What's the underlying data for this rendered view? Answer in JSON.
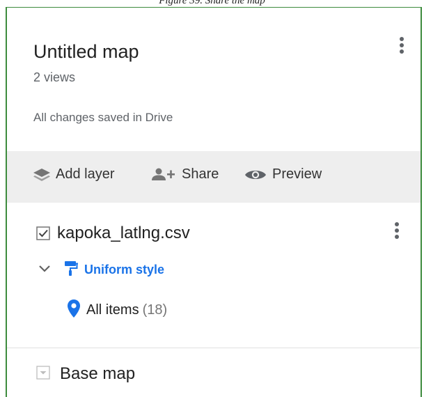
{
  "caption": "Figure 39. Share the map",
  "map": {
    "title": "Untitled map",
    "views": "2 views",
    "save_status": "All changes saved in Drive"
  },
  "toolbar": {
    "add_layer": "Add layer",
    "share": "Share",
    "preview": "Preview"
  },
  "layer": {
    "name": "kapoka_latlng.csv",
    "checked": true,
    "style": "Uniform style",
    "items_label": "All items",
    "items_count": "(18)"
  },
  "base_map": {
    "label": "Base map"
  },
  "colors": {
    "accent": "#1a73e8",
    "frame": "#3d8b3d",
    "toolbar_bg": "#eeeeee"
  }
}
